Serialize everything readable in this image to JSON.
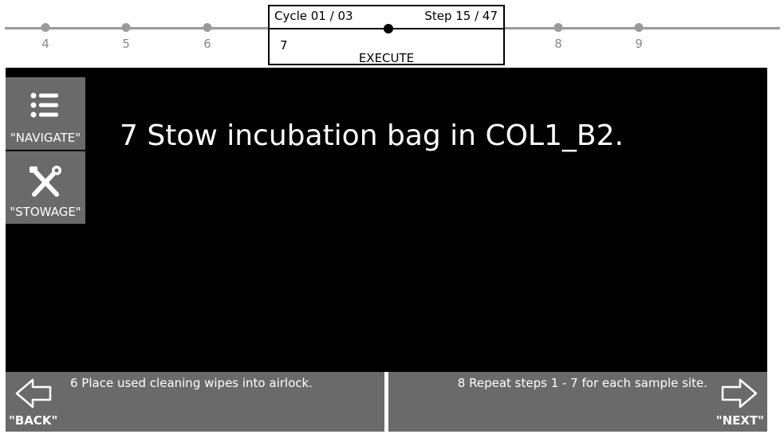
{
  "timeline": {
    "steps_left": [
      "4",
      "5",
      "6"
    ],
    "steps_right": [
      "8",
      "9"
    ]
  },
  "current_step": {
    "cycle": "Cycle 01 / 03",
    "step": "Step 15 / 47",
    "number": "7",
    "status": "EXECUTE"
  },
  "main": {
    "instruction": "7 Stow incubation bag in COL1_B2."
  },
  "sidebar": {
    "navigate_label": "\"NAVIGATE\"",
    "navigate_icon": "list-icon",
    "stowage_label": "\"STOWAGE\"",
    "stowage_icon": "tools-icon"
  },
  "footer": {
    "back_preview": "6 Place used cleaning wipes into airlock.",
    "back_label": "\"BACK\"",
    "next_preview": "8 Repeat steps 1 - 7 for each sample site.",
    "next_label": "\"NEXT\""
  },
  "colors": {
    "screen_bg": "#000000",
    "button_bg": "#6a6a6a",
    "timeline": "#9a9a9a"
  }
}
